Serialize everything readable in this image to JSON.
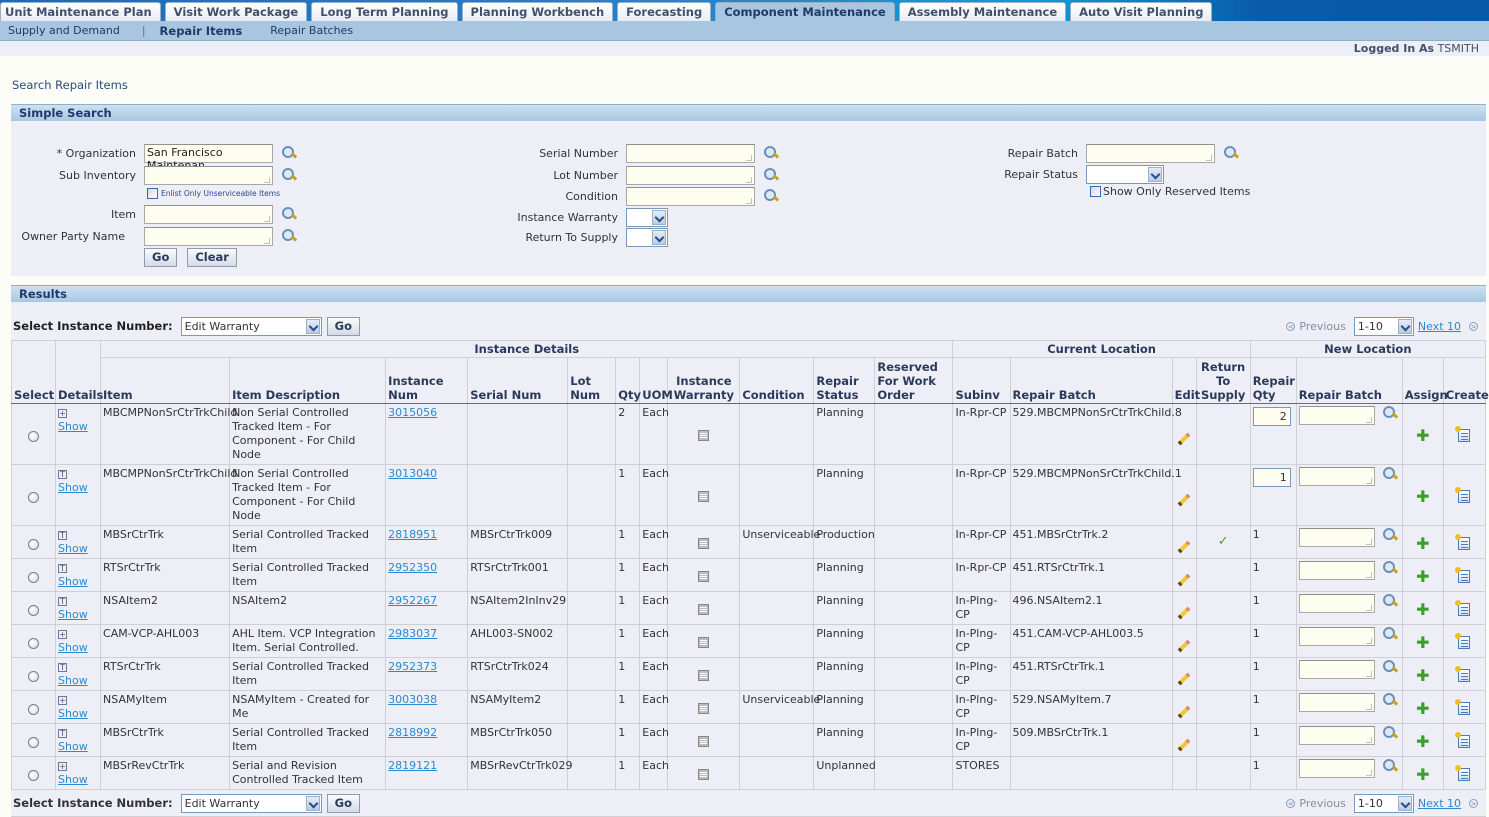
{
  "tabs": [
    {
      "label": "Unit Maintenance Plan",
      "active": false
    },
    {
      "label": "Visit Work Package",
      "active": false
    },
    {
      "label": "Long Term Planning",
      "active": false
    },
    {
      "label": "Planning Workbench",
      "active": false
    },
    {
      "label": "Forecasting",
      "active": false
    },
    {
      "label": "Component Maintenance",
      "active": true
    },
    {
      "label": "Assembly Maintenance",
      "active": false
    },
    {
      "label": "Auto Visit Planning",
      "active": false
    }
  ],
  "subnav": {
    "supply_demand": "Supply and Demand",
    "separator": "|",
    "repair_items": "Repair Items",
    "repair_batches": "Repair Batches"
  },
  "user": {
    "label": "Logged In As",
    "name": "TSMITH"
  },
  "page_title": "Search Repair Items",
  "simple_search": {
    "title": "Simple Search",
    "organization_label": "* Organization",
    "organization_value": "San Francisco Maintenan",
    "sub_inventory_label": "Sub Inventory",
    "enlist_unserviceable_label": "Enlist Only Unserviceable Items",
    "item_label": "Item",
    "owner_party_label": "Owner Party Name",
    "serial_number_label": "Serial Number",
    "lot_number_label": "Lot Number",
    "condition_label": "Condition",
    "instance_warranty_label": "Instance Warranty",
    "return_to_supply_label": "Return To Supply",
    "repair_batch_label": "Repair Batch",
    "repair_status_label": "Repair Status",
    "show_reserved_label": "Show Only Reserved Items",
    "go_label": "Go",
    "clear_label": "Clear"
  },
  "results": {
    "title": "Results",
    "select_instance_label": "Select Instance Number:",
    "action_value": "Edit Warranty",
    "go_label": "Go",
    "pager": {
      "previous": "Previous",
      "range": "1-10",
      "next": "Next 10"
    },
    "group_headers": {
      "instance_details": "Instance Details",
      "current_location": "Current Location",
      "new_location": "New Location"
    },
    "columns": {
      "select": "Select",
      "details": "Details",
      "item": "Item",
      "item_description": "Item Description",
      "instance_num": "Instance Num",
      "serial_num": "Serial Num",
      "lot_num": "Lot Num",
      "qty": "Qty",
      "uom": "UOM",
      "instance_warranty": "Instance Warranty",
      "condition": "Condition",
      "repair_status": "Repair Status",
      "reserved_for_work_order": "Reserved For Work Order",
      "subinv": "Subinv",
      "repair_batch": "Repair Batch",
      "edit": "Edit",
      "return_to_supply": "Return To Supply",
      "repair_qty": "Repair Qty",
      "new_repair_batch": "Repair Batch",
      "assign": "Assign",
      "create": "Create"
    },
    "show_label": "Show",
    "rows": [
      {
        "expander": "+",
        "item": "MBCMPNonSrCtrTrkChild",
        "description": "Non Serial Controlled Tracked Item - For Component - For Child Node",
        "instance_num": "3015056",
        "serial_num": "",
        "lot_num": "",
        "qty": "2",
        "uom": "Each",
        "condition": "",
        "repair_status": "Planning",
        "reserved": "",
        "subinv": "In-Rpr-CP",
        "repair_batch": "529.MBCMPNonSrCtrTrkChild.8",
        "editable": true,
        "return_to_supply": false,
        "repair_qty": "2",
        "repair_qty_editable": true
      },
      {
        "expander": "T",
        "item": "MBCMPNonSrCtrTrkChild",
        "description": "Non Serial Controlled Tracked Item - For Component - For Child Node",
        "instance_num": "3013040",
        "serial_num": "",
        "lot_num": "",
        "qty": "1",
        "uom": "Each",
        "condition": "",
        "repair_status": "Planning",
        "reserved": "",
        "subinv": "In-Rpr-CP",
        "repair_batch": "529.MBCMPNonSrCtrTrkChild.1",
        "editable": true,
        "return_to_supply": false,
        "repair_qty": "1",
        "repair_qty_editable": true
      },
      {
        "expander": "T",
        "item": "MBSrCtrTrk",
        "description": "Serial Controlled Tracked Item",
        "instance_num": "2818951",
        "serial_num": "MBSrCtrTrk009",
        "lot_num": "",
        "qty": "1",
        "uom": "Each",
        "condition": "Unserviceable",
        "repair_status": "Production",
        "reserved": "",
        "subinv": "In-Rpr-CP",
        "repair_batch": "451.MBSrCtrTrk.2",
        "editable": true,
        "return_to_supply": true,
        "repair_qty": "1",
        "repair_qty_editable": false
      },
      {
        "expander": "T",
        "item": "RTSrCtrTrk",
        "description": "Serial Controlled Tracked Item",
        "instance_num": "2952350",
        "serial_num": "RTSrCtrTrk001",
        "lot_num": "",
        "qty": "1",
        "uom": "Each",
        "condition": "",
        "repair_status": "Planning",
        "reserved": "",
        "subinv": "In-Rpr-CP",
        "repair_batch": "451.RTSrCtrTrk.1",
        "editable": true,
        "return_to_supply": false,
        "repair_qty": "1",
        "repair_qty_editable": false
      },
      {
        "expander": "T",
        "item": "NSAItem2",
        "description": "NSAItem2",
        "instance_num": "2952267",
        "serial_num": "NSAItem2InInv29",
        "lot_num": "",
        "qty": "1",
        "uom": "Each",
        "condition": "",
        "repair_status": "Planning",
        "reserved": "",
        "subinv": "In-Plng-CP",
        "repair_batch": "496.NSAItem2.1",
        "editable": true,
        "return_to_supply": false,
        "repair_qty": "1",
        "repair_qty_editable": false
      },
      {
        "expander": "+",
        "item": "CAM-VCP-AHL003",
        "description": "AHL Item. VCP Integration Item. Serial Controlled.",
        "instance_num": "2983037",
        "serial_num": "AHL003-SN002",
        "lot_num": "",
        "qty": "1",
        "uom": "Each",
        "condition": "",
        "repair_status": "Planning",
        "reserved": "",
        "subinv": "In-Plng-CP",
        "repair_batch": "451.CAM-VCP-AHL003.5",
        "editable": true,
        "return_to_supply": false,
        "repair_qty": "1",
        "repair_qty_editable": false
      },
      {
        "expander": "T",
        "item": "RTSrCtrTrk",
        "description": "Serial Controlled Tracked Item",
        "instance_num": "2952373",
        "serial_num": "RTSrCtrTrk024",
        "lot_num": "",
        "qty": "1",
        "uom": "Each",
        "condition": "",
        "repair_status": "Planning",
        "reserved": "",
        "subinv": "In-Plng-CP",
        "repair_batch": "451.RTSrCtrTrk.1",
        "editable": true,
        "return_to_supply": false,
        "repair_qty": "1",
        "repair_qty_editable": false
      },
      {
        "expander": "+",
        "item": "NSAMyItem",
        "description": "NSAMyItem - Created for Me",
        "instance_num": "3003038",
        "serial_num": "NSAMyItem2",
        "lot_num": "",
        "qty": "1",
        "uom": "Each",
        "condition": "Unserviceable",
        "repair_status": "Planning",
        "reserved": "",
        "subinv": "In-Plng-CP",
        "repair_batch": "529.NSAMyItem.7",
        "editable": true,
        "return_to_supply": false,
        "repair_qty": "1",
        "repair_qty_editable": false
      },
      {
        "expander": "T",
        "item": "MBSrCtrTrk",
        "description": "Serial Controlled Tracked Item",
        "instance_num": "2818992",
        "serial_num": "MBSrCtrTrk050",
        "lot_num": "",
        "qty": "1",
        "uom": "Each",
        "condition": "",
        "repair_status": "Planning",
        "reserved": "",
        "subinv": "In-Plng-CP",
        "repair_batch": "509.MBSrCtrTrk.1",
        "editable": true,
        "return_to_supply": false,
        "repair_qty": "1",
        "repair_qty_editable": false
      },
      {
        "expander": "+",
        "item": "MBSrRevCtrTrk",
        "description": "Serial and Revision Controlled Tracked Item",
        "instance_num": "2819121",
        "serial_num": "MBSrRevCtrTrk029",
        "lot_num": "",
        "qty": "1",
        "uom": "Each",
        "condition": "",
        "repair_status": "Unplanned",
        "reserved": "",
        "subinv": "STORES",
        "repair_batch": "",
        "editable": false,
        "return_to_supply": false,
        "repair_qty": "1",
        "repair_qty_editable": false
      }
    ]
  }
}
